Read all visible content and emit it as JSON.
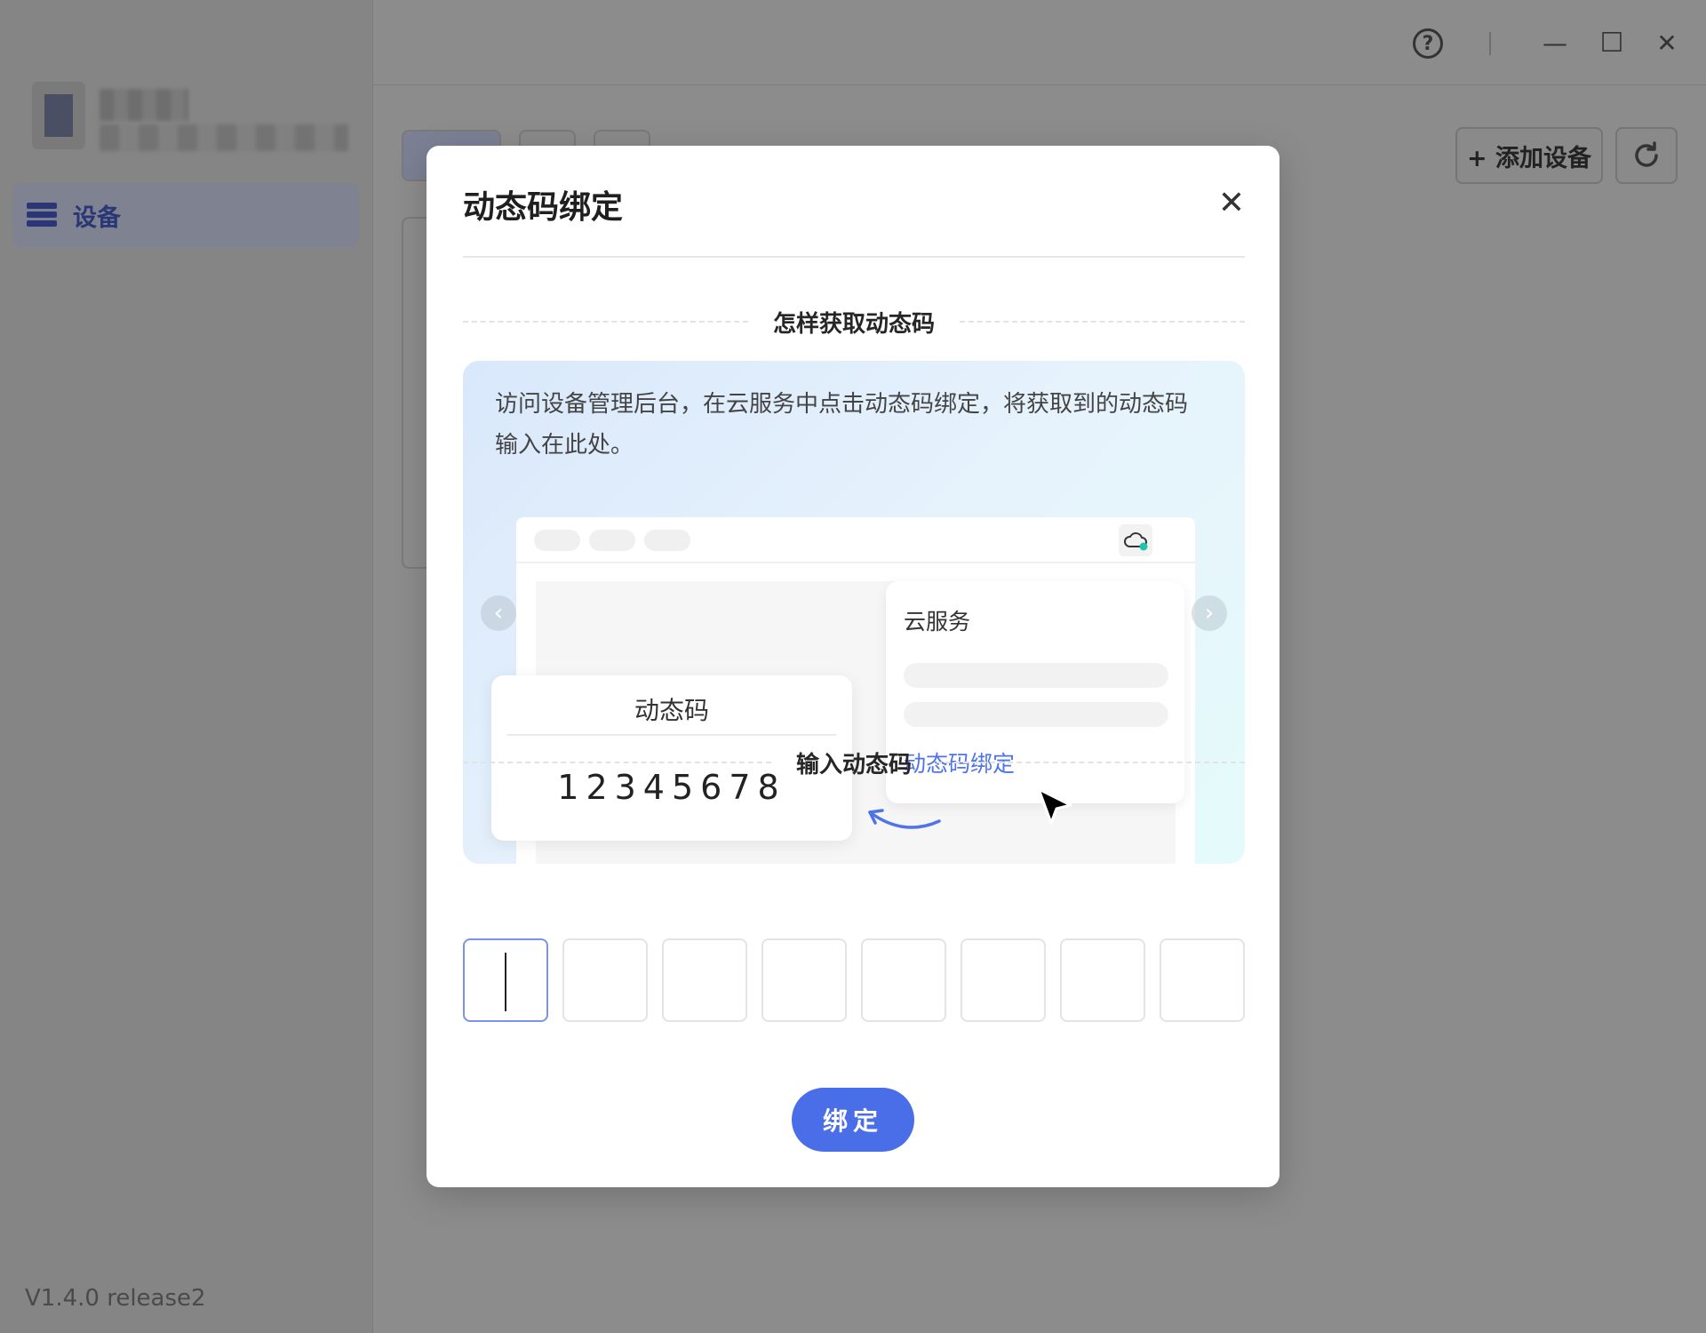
{
  "sidebar": {
    "nav_items": [
      {
        "label": "设备",
        "icon": "server-icon"
      }
    ],
    "version": "V1.4.0 release2"
  },
  "window_controls": {
    "help_glyph": "?",
    "minimize_glyph": "—",
    "maximize_glyph": "☐",
    "close_glyph": "✕"
  },
  "toolbar": {
    "add_device_label": "+ 添加设备"
  },
  "modal": {
    "title": "动态码绑定",
    "close_glyph": "✕",
    "guide_heading": "怎样获取动态码",
    "guide_text": "访问设备管理后台，在云服务中点击动态码绑定，将获取到的动态码输入在此处。",
    "illustration": {
      "cloud_card_title": "云服务",
      "cloud_card_link": "动态码绑定",
      "code_card_title": "动态码",
      "code_card_digits": "12345678",
      "prev_glyph": "‹",
      "next_glyph": "›"
    },
    "input_heading": "输入动态码",
    "code_inputs": [
      "",
      "",
      "",
      "",
      "",
      "",
      "",
      ""
    ],
    "bind_label": "绑定"
  },
  "colors": {
    "accent": "#4a6ee8",
    "link": "#4f73e8",
    "overlay": "#8c8c8c"
  }
}
